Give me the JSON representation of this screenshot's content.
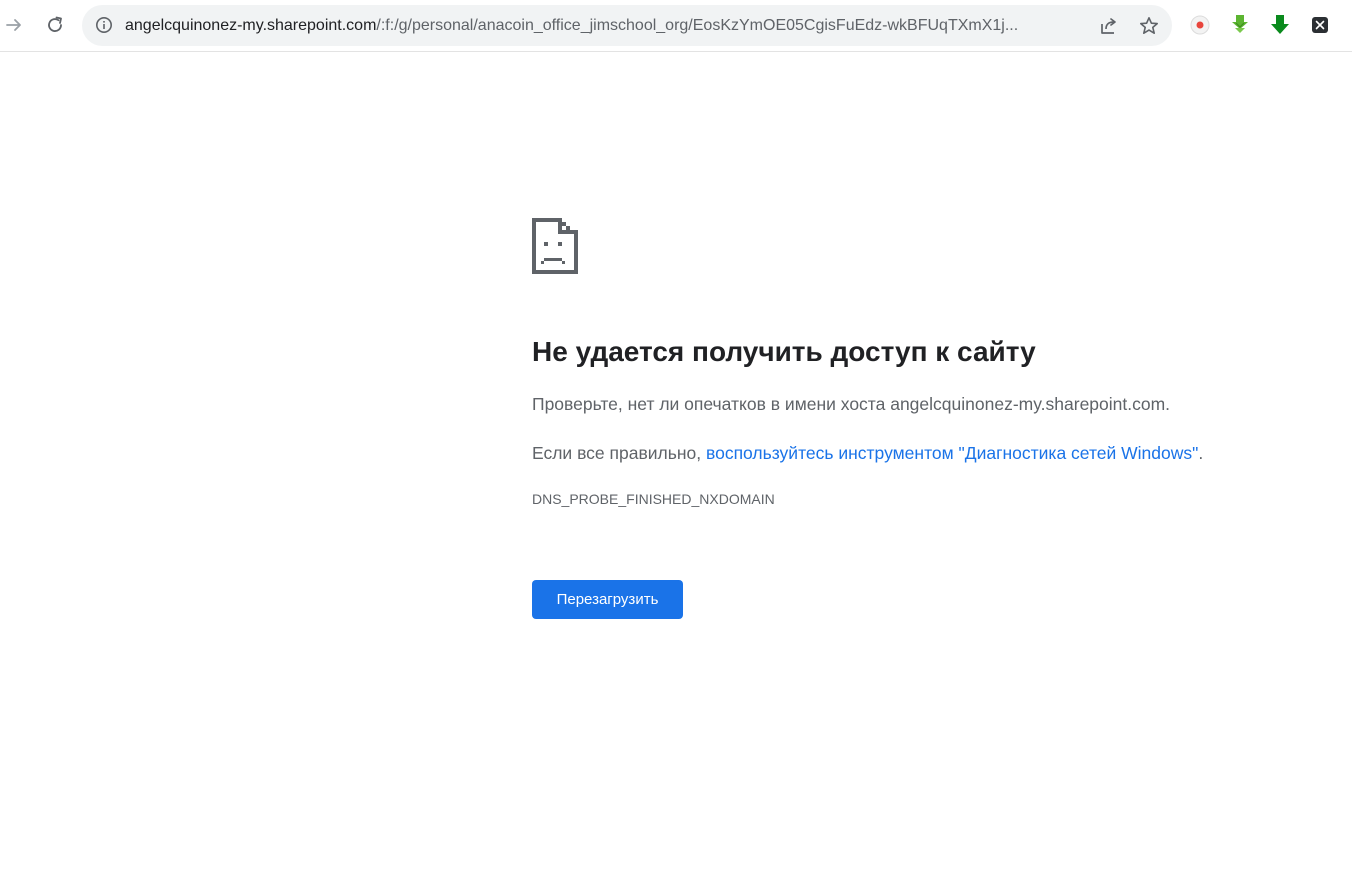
{
  "browser": {
    "url_host": "angelcquinonez-my.sharepoint.com",
    "url_path": "/:f:/g/personal/anacoin_office_jimschool_org/EosKzYmOE05CgisFuEdz-wkBFUqTXmX1j...",
    "icons": {
      "forward": "arrow-right-icon",
      "reload": "reload-icon",
      "info": "info-icon",
      "share": "share-icon",
      "bookmark": "star-icon"
    },
    "extensions": [
      {
        "name": "red-dot-extension-icon",
        "color": "#e8453c"
      },
      {
        "name": "green-download-extension-icon",
        "color": "#5cb531"
      },
      {
        "name": "green-arrow-extension-icon",
        "color": "#0a8a1d"
      },
      {
        "name": "x-extension-icon",
        "color": "#2b2f33"
      }
    ]
  },
  "error_page": {
    "icon": "sad-document-icon",
    "title": "Не удается получить доступ к сайту",
    "line1": "Проверьте, нет ли опечатков в имени хоста angelcquinonez-my.sharepoint.com.",
    "line2_prefix": "Если все правильно, ",
    "line2_link": "воспользуйтесь инструментом \"Диагностика сетей Windows\"",
    "line2_suffix": ".",
    "error_code": "DNS_PROBE_FINISHED_NXDOMAIN",
    "reload_label": "Перезагрузить",
    "accent_color": "#1a73e8"
  }
}
